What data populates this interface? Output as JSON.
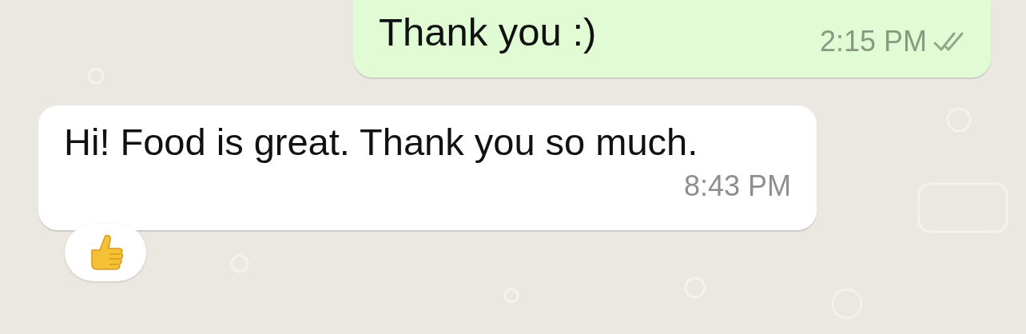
{
  "messages": [
    {
      "kind": "outgoing",
      "text": "Thank you :)",
      "time": "2:15 PM",
      "read": true,
      "reaction": false
    },
    {
      "kind": "incoming",
      "text": "Hi! Food is great. Thank you so much.",
      "time": "8:43 PM",
      "read": false,
      "reaction": true
    }
  ]
}
